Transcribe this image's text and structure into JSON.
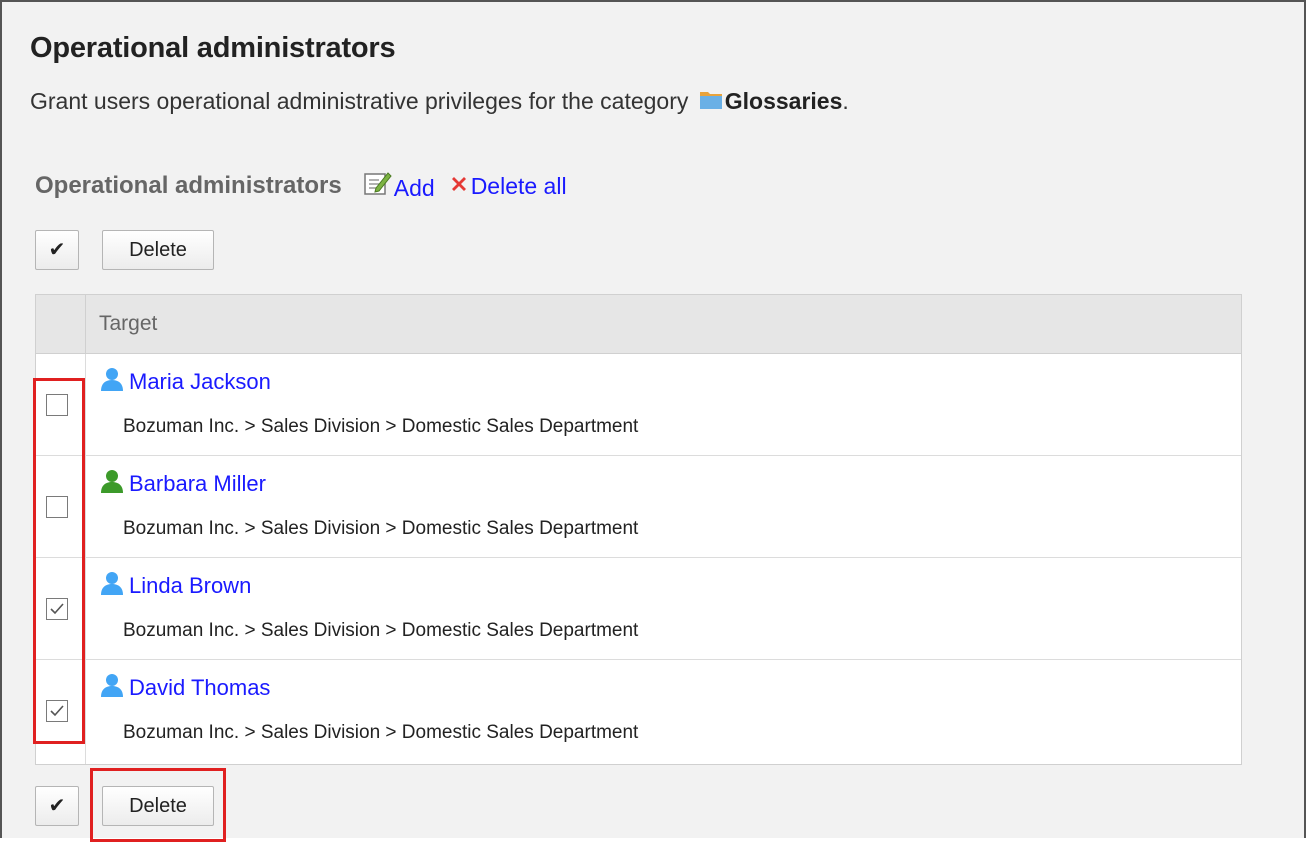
{
  "header": {
    "title": "Operational administrators",
    "description_prefix": "Grant users operational administrative privileges for the category",
    "category_name": "Glossaries",
    "description_suffix": "."
  },
  "section": {
    "label": "Operational administrators",
    "add_label": "Add",
    "delete_all_label": "Delete all"
  },
  "toolbar": {
    "check_all_glyph": "✔",
    "delete_label": "Delete"
  },
  "table": {
    "columns": [
      "Target"
    ],
    "rows": [
      {
        "name": "Maria Jackson",
        "path": "Bozuman Inc. > Sales Division > Domestic Sales Department",
        "checked": false,
        "icon_color": "#42a5f5"
      },
      {
        "name": "Barbara Miller",
        "path": "Bozuman Inc. > Sales Division > Domestic Sales Department",
        "checked": false,
        "icon_color": "#3c9a2a"
      },
      {
        "name": "Linda Brown",
        "path": "Bozuman Inc. > Sales Division > Domestic Sales Department",
        "checked": true,
        "icon_color": "#42a5f5"
      },
      {
        "name": "David Thomas",
        "path": "Bozuman Inc. > Sales Division > Domestic Sales Department",
        "checked": true,
        "icon_color": "#42a5f5"
      }
    ]
  },
  "colors": {
    "link": "#1a1aff",
    "highlight": "#e02020",
    "background": "#f2f2f2"
  }
}
